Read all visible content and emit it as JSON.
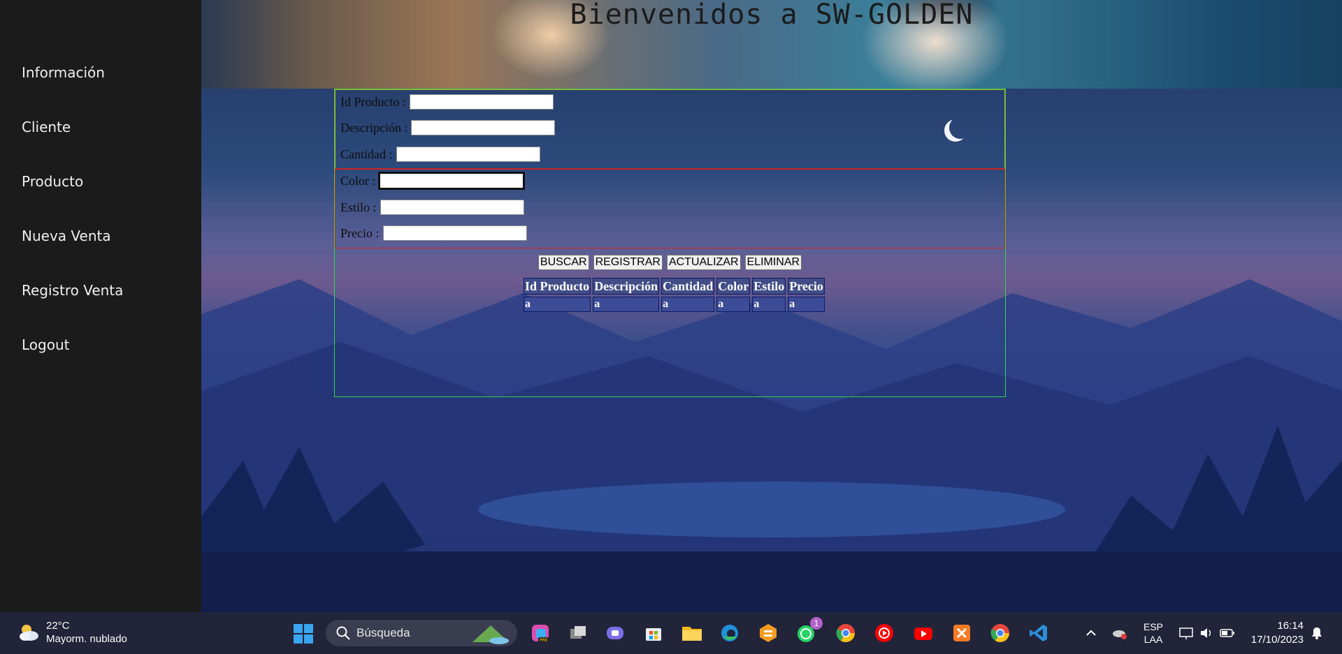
{
  "sidebar": {
    "items": [
      {
        "label": "Información"
      },
      {
        "label": "Cliente"
      },
      {
        "label": "Producto"
      },
      {
        "label": "Nueva Venta"
      },
      {
        "label": "Registro Venta"
      },
      {
        "label": "Logout"
      }
    ]
  },
  "banner": {
    "title": "Bienvenidos a  SW-GOLDEN"
  },
  "form": {
    "fields": [
      {
        "label": "Id Producto :",
        "value": ""
      },
      {
        "label": "Descripción :",
        "value": ""
      },
      {
        "label": "Cantidad :",
        "value": ""
      },
      {
        "label": "Color :",
        "value": ""
      },
      {
        "label": "Estilo :",
        "value": ""
      },
      {
        "label": "Precio :",
        "value": ""
      }
    ],
    "buttons": {
      "search": "BUSCAR",
      "register": "REGISTRAR",
      "update": "ACTUALIZAR",
      "delete": "ELIMINAR"
    }
  },
  "table": {
    "headers": [
      "Id Producto",
      "Descripción",
      "Cantidad",
      "Color",
      "Estilo",
      "Precio"
    ],
    "rows": [
      [
        "a",
        "a",
        "a",
        "a",
        "a",
        "a"
      ]
    ]
  },
  "taskbar": {
    "weather": {
      "temp": "22°C",
      "desc": "Mayorm. nublado"
    },
    "search_placeholder": "Búsqueda",
    "whatsapp_badge": "1",
    "lang": {
      "code": "ESP",
      "layout": "LAA"
    },
    "time": "16:14",
    "date": "17/10/2023"
  }
}
